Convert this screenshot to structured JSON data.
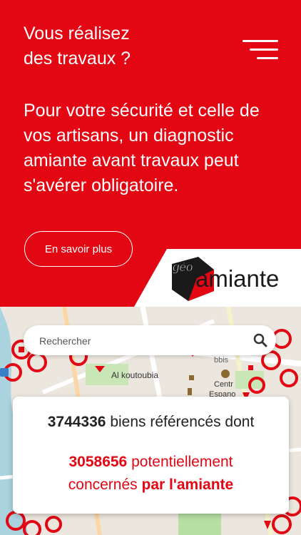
{
  "hero": {
    "title_line1": "Vous réalisez",
    "title_line2": "des travaux ?",
    "text": "Pour votre sécurité et celle de vos artisans, un diagnostic amiante avant travaux peut s'avérer obligatoire.",
    "learn_more_label": "En savoir plus"
  },
  "logo": {
    "part1": "géo",
    "part2": "amiante"
  },
  "search": {
    "placeholder": "Rechercher"
  },
  "map": {
    "labels": [
      "Al koutoubia",
      "Centr",
      "Espano",
      "bbis"
    ]
  },
  "stats": {
    "total_count": "3744336",
    "total_text": " biens référencés dont",
    "concerned_count": "3058656",
    "concerned_text": " potentiellement",
    "concerned_text2": "concernés ",
    "concerned_bold": "par l'amiante"
  },
  "colors": {
    "brand_red": "#e30613",
    "text_dark": "#222222"
  },
  "icons": [
    "menu-icon",
    "search-icon"
  ]
}
